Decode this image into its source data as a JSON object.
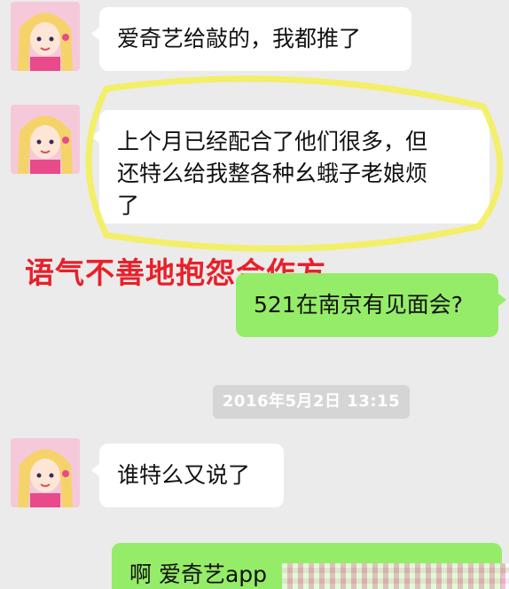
{
  "messages": [
    {
      "side": "left",
      "text": "爱奇艺给敲的，我都推了"
    },
    {
      "side": "left",
      "lines": [
        "上个月已经配合了他们很多，但",
        "还特么给我整各种幺蛾子老娘烦",
        "了"
      ]
    },
    {
      "side": "right",
      "text": "521在南京有见面会?"
    },
    {
      "side": "left",
      "text": "谁特么又说了"
    },
    {
      "side": "right",
      "text": "啊 爱奇艺app"
    }
  ],
  "timestamp": "2016年5月2日  13:15",
  "annotation": "语气不善地抱怨合作方",
  "colors": {
    "background": "#ebebeb",
    "bubble_left": "#ffffff",
    "bubble_right": "#95ec69",
    "annotation": "#e8202a",
    "highlight": "#f4f05a"
  },
  "icons": {
    "avatar": "anime-girl-avatar-icon"
  }
}
